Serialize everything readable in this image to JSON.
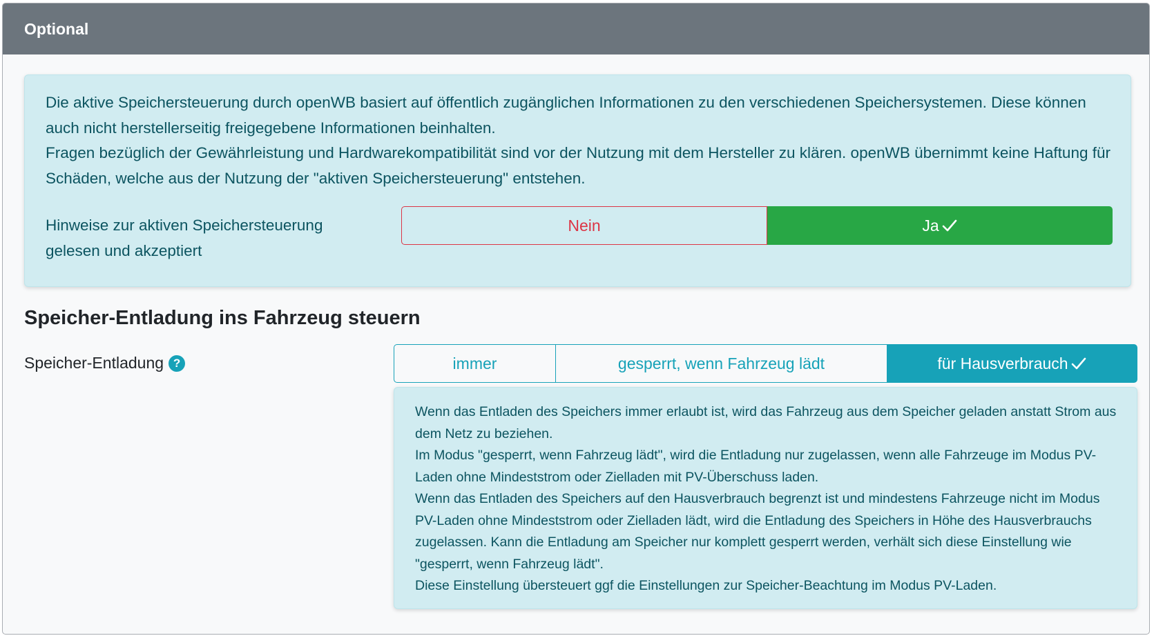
{
  "card": {
    "header": "Optional"
  },
  "alert": {
    "paragraph1": "Die aktive Speichersteuerung durch openWB basiert auf öffentlich zugänglichen Informationen zu den verschiedenen Speichersystemen. Diese können auch nicht herstellerseitig freigegebene Informationen beinhalten.",
    "paragraph2": "Fragen bezüglich der Gewährleistung und Hardwarekompatibilität sind vor der Nutzung mit dem Hersteller zu klären. openWB übernimmt keine Haftung für Schäden, welche aus der Nutzung der \"aktiven Speichersteuerung\" entstehen.",
    "ack_label": "Hinweise zur aktiven Speichersteuerung gelesen und akzeptiert",
    "options": {
      "no": "Nein",
      "yes": "Ja"
    },
    "selected": "yes"
  },
  "section": {
    "title": "Speicher-Entladung ins Fahrzeug steuern"
  },
  "discharge": {
    "label": "Speicher-Entladung",
    "help_icon": "?",
    "options": {
      "always": "immer",
      "blocked": "gesperrt, wenn Fahrzeug lädt",
      "house": "für Hausverbrauch"
    },
    "selected": "house",
    "info": [
      "Wenn das Entladen des Speichers immer erlaubt ist, wird das Fahrzeug aus dem Speicher geladen anstatt Strom aus dem Netz zu beziehen.",
      "Im Modus \"gesperrt, wenn Fahrzeug lädt\", wird die Entladung nur zugelassen, wenn alle Fahrzeuge im Modus PV-Laden ohne Mindeststrom oder Zielladen mit PV-Überschuss laden.",
      "Wenn das Entladen des Speichers auf den Hausverbrauch begrenzt ist und mindestens Fahrzeuge nicht im Modus PV-Laden ohne Mindeststrom oder Zielladen lädt, wird die Entladung des Speichers in Höhe des Hausverbrauchs zugelassen. Kann die Entladung am Speicher nur komplett gesperrt werden, verhält sich diese Einstellung wie \"gesperrt, wenn Fahrzeug lädt\".",
      "Diese Einstellung übersteuert ggf die Einstellungen zur Speicher-Beachtung im Modus PV-Laden."
    ]
  },
  "colors": {
    "header_bg": "#6c757d",
    "info_bg": "#d1ecf1",
    "info_text": "#0c5460",
    "danger": "#dc3545",
    "success": "#28a745",
    "accent": "#17a2b8"
  }
}
